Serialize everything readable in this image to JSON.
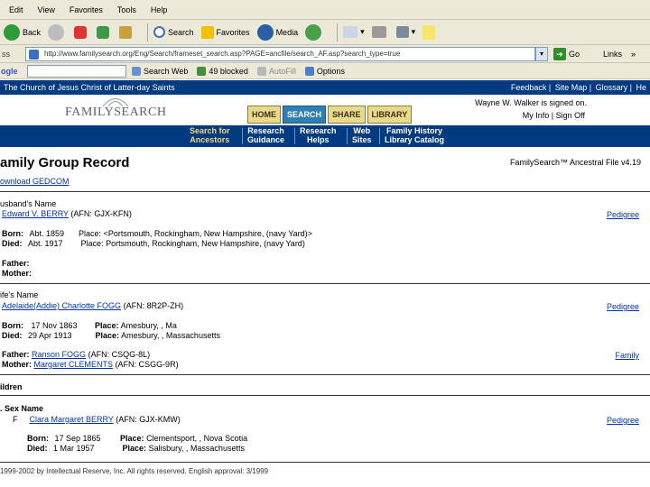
{
  "browser": {
    "menu": [
      "Edit",
      "View",
      "Favorites",
      "Tools",
      "Help"
    ],
    "toolbar": {
      "back": "Back",
      "search": "Search",
      "favorites": "Favorites",
      "media": "Media"
    },
    "address": {
      "label": "ss",
      "url": "http://www.familysearch.org/Eng/Search/frameset_search.asp?PAGE=ancfile/search_AF.asp?search_type=true",
      "go": "Go",
      "links": "Links"
    },
    "google": {
      "logo": "ogle",
      "search_web": "Search Web",
      "blocked": "49 blocked",
      "autofill": "AutoFill",
      "options": "Options"
    }
  },
  "page": {
    "church": "The Church of Jesus Christ of Latter-day Saints",
    "toplinks": [
      "Feedback",
      "Site Map",
      "Glossary",
      "He"
    ],
    "logo": "FAMILYSEARCH",
    "tabs": [
      "HOME",
      "SEARCH",
      "SHARE",
      "LIBRARY"
    ],
    "signed_in": "Wayne W. Walker is signed on.",
    "my_info": "My Info",
    "sign_off": "Sign Off",
    "nav": [
      {
        "l1": "Search for",
        "l2": "Ancestors"
      },
      {
        "l1": "Research",
        "l2": "Guidance"
      },
      {
        "l1": "Research",
        "l2": "Helps"
      },
      {
        "l1": "Web",
        "l2": "Sites"
      },
      {
        "l1": "Family History",
        "l2": "Library Catalog"
      }
    ],
    "title": "amily Group Record",
    "file_version": "FamilySearch™ Ancestral File v4.19",
    "gedcom": "ownload GEDCOM",
    "husband": {
      "heading": "usband's Name",
      "name": "Edward V. BERRY",
      "afn": "(AFN: GJX-KFN)",
      "pedigree": "Pedigree",
      "born_label": "Born:",
      "born": "Abt. 1859",
      "born_place_label": "Place:",
      "born_place": "<Portsmouth, Rockingham, New Hampshire, (navy Yard)>",
      "died_label": "Died:",
      "died": "Abt. 1917",
      "died_place_label": "Place:",
      "died_place": "Portsmouth, Rockingham, New Hampshire, (navy Yard)",
      "father_label": "Father:",
      "mother_label": "Mother:"
    },
    "wife": {
      "heading": "ife's Name",
      "name": "Adelaide(Addie) Charlotte FOGG",
      "afn": "(AFN: 8R2P-ZH)",
      "pedigree": "Pedigree",
      "born_label": "Born:",
      "born": "17 Nov 1863",
      "born_place_label": "Place:",
      "born_place": "Amesbury, , Ma",
      "died_label": "Died:",
      "died": "29 Apr 1913",
      "died_place_label": "Place:",
      "died_place": "Amesbury, , Massachusetts",
      "father_label": "Father:",
      "father": "Ranson FOGG",
      "father_afn": "(AFN: CSQG-8L)",
      "mother_label": "Mother:",
      "mother": "Margaret CLEMENTS",
      "mother_afn": "(AFN: CSGG-9R)",
      "family": "Family"
    },
    "children": {
      "heading": "ildren",
      "col_header": ". Sex Name",
      "child": {
        "sex": "F",
        "name": "Clara Margaret BERRY",
        "afn": "(AFN: GJX-KMW)",
        "pedigree": "Pedigree",
        "born_label": "Born:",
        "born": "17 Sep 1865",
        "born_place_label": "Place:",
        "born_place": "Clementsport, , Nova Scotia",
        "died_label": "Died:",
        "died": "1 Mar 1957",
        "died_place_label": "Place:",
        "died_place": "Salisbury, , Massachusetts"
      }
    },
    "copyright": "1999-2002 by Intellectual Reserve, Inc. All rights reserved. English approval: 3/1999"
  }
}
